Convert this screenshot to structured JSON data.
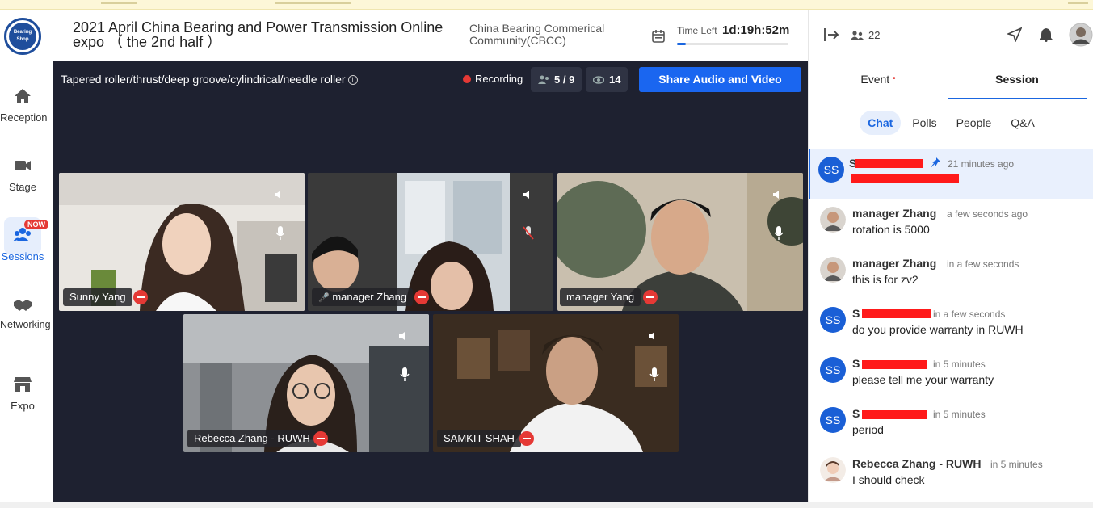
{
  "nav": {
    "logo_text": "Bearing Shop",
    "items": [
      {
        "label": "Reception"
      },
      {
        "label": "Stage"
      },
      {
        "label": "Sessions",
        "badge": "NOW"
      },
      {
        "label": "Networking"
      },
      {
        "label": "Expo"
      }
    ]
  },
  "header": {
    "event_title": "2021 April China Bearing and Power Transmission Online expo （ the 2nd half ）",
    "organizer": "China Bearing Commerical Community(CBCC)",
    "time_left_label": "Time Left",
    "time_left_value": "1d:19h:52m",
    "time_progress_fraction": 0.08
  },
  "stage": {
    "session_title": "Tapered roller/thrust/deep groove/cylindrical/needle roller",
    "recording_label": "Recording",
    "speakers_count": "5 / 9",
    "viewers_count": "14",
    "share_button": "Share Audio and Video",
    "participants": [
      {
        "name": "Sunny Yang"
      },
      {
        "name": "manager Zhang"
      },
      {
        "name": "manager Yang"
      },
      {
        "name": "Rebecca Zhang - RUWH"
      },
      {
        "name": "SAMKIT SHAH"
      }
    ]
  },
  "panel": {
    "online_count": "22",
    "tabs": [
      {
        "label": "Event"
      },
      {
        "label": "Session"
      }
    ],
    "subtabs": [
      {
        "label": "Chat"
      },
      {
        "label": "Polls"
      },
      {
        "label": "People"
      },
      {
        "label": "Q&A"
      }
    ],
    "messages": [
      {
        "initials": "SS",
        "name": "S",
        "time": "21 minutes ago",
        "text": ""
      },
      {
        "initials": "",
        "name": "manager Zhang",
        "time": "a few seconds ago",
        "text": "rotation is 5000"
      },
      {
        "initials": "",
        "name": "manager Zhang",
        "time": "in a few seconds",
        "text": "this is for zv2"
      },
      {
        "initials": "SS",
        "name": "S",
        "time": "in a few seconds",
        "text": "do you provide warranty in RUWH"
      },
      {
        "initials": "SS",
        "name": "S",
        "time": "in 5 minutes",
        "text": "please tell me your warranty"
      },
      {
        "initials": "SS",
        "name": "S",
        "time": "in 5 minutes",
        "text": "period"
      },
      {
        "initials": "",
        "name": "Rebecca Zhang - RUWH",
        "time": "in 5 minutes",
        "text": "I should check"
      }
    ]
  },
  "colors": {
    "accent": "#1a66e0",
    "stage_bg": "#1e2130",
    "danger": "#e53935"
  }
}
